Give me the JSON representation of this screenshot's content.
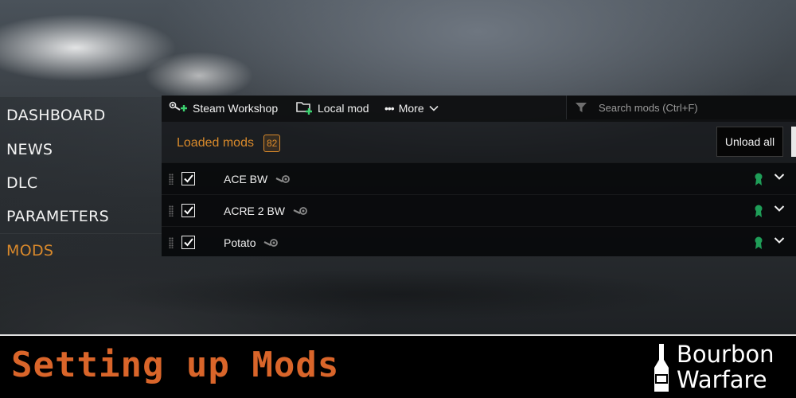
{
  "nav": {
    "items": [
      {
        "label": "DASHBOARD",
        "active": false
      },
      {
        "label": "NEWS",
        "active": false
      },
      {
        "label": "DLC",
        "active": false
      },
      {
        "label": "PARAMETERS",
        "active": false
      },
      {
        "label": "MODS",
        "active": true
      }
    ]
  },
  "toolbar": {
    "steam_workshop_label": "Steam Workshop",
    "local_mod_label": "Local mod",
    "more_label": "More",
    "search_placeholder": "Search mods (Ctrl+F)"
  },
  "loaded": {
    "label": "Loaded mods",
    "count": "82",
    "unload_all_label": "Unload all"
  },
  "mods": [
    {
      "name": "ACE BW",
      "checked": true,
      "source_icon": "steam-icon"
    },
    {
      "name": "ACRE 2 BW",
      "checked": true,
      "source_icon": "steam-icon"
    },
    {
      "name": "Potato",
      "checked": true,
      "source_icon": "steam-icon"
    }
  ],
  "banner": {
    "title": "Setting up Mods",
    "logo_line1": "Bourbon",
    "logo_line2": "Warfare"
  },
  "colors": {
    "accent": "#d9892b",
    "banner_title": "#d9652a",
    "add_green": "#3bd16f",
    "ribbon_green": "#1f9e58"
  }
}
